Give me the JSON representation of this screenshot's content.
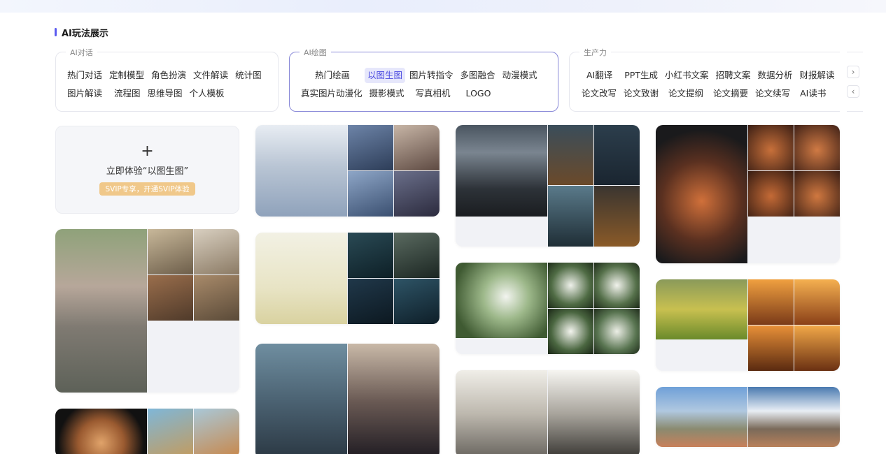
{
  "section_title": "AI玩法展示",
  "categories": [
    {
      "label": "AI对话",
      "rows": [
        [
          "热门对话",
          "定制模型",
          "角色扮演",
          "文件解读",
          "统计图"
        ],
        [
          "图片解读",
          "流程图",
          "思维导图",
          "个人模板"
        ]
      ]
    },
    {
      "label": "AI绘图",
      "rows": [
        [
          "热门绘画",
          "以图生图",
          "图片转指令",
          "多图融合",
          "动漫模式"
        ],
        [
          "真实图片动漫化",
          "摄影模式",
          "写真相机",
          "LOGO"
        ]
      ],
      "selected": "以图生图"
    },
    {
      "label": "生产力",
      "rows": [
        [
          "AI翻译",
          "PPT生成",
          "小红书文案",
          "招聘文案",
          "数据分析",
          "财报解读"
        ],
        [
          "论文改写",
          "论文致谢",
          "论文提纲",
          "论文摘要",
          "论文续写",
          "AI读书"
        ]
      ]
    }
  ],
  "nav": {
    "next": "›",
    "prev": "‹"
  },
  "try_card": {
    "plus": "+",
    "text": "立即体验“以图生图”",
    "badge": "SVIP专享，开通SVIP体验"
  },
  "colors": {
    "accent": "#5b5bf0",
    "svip": "#f0c88a",
    "card_bg": "#f1f2f6"
  }
}
